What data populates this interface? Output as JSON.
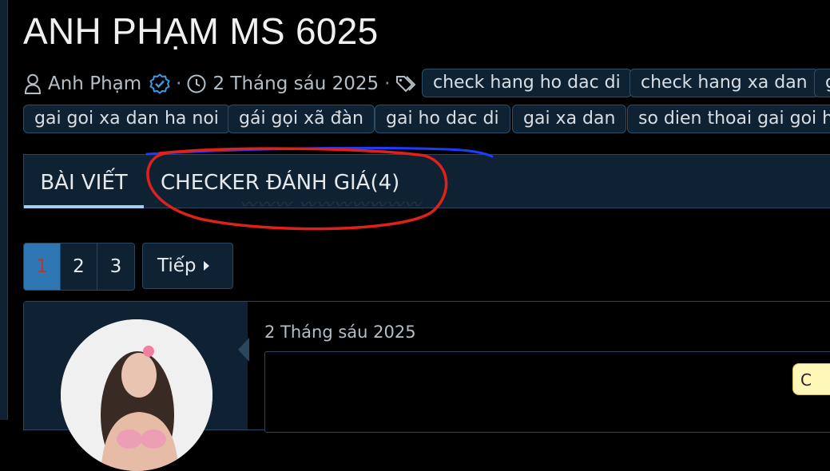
{
  "thread": {
    "title": "ANH PHẠM MS 6025",
    "author": "Anh Phạm",
    "date": "2 Tháng sáu 2025",
    "tags": [
      "check hang ho dac di",
      "check hang xa dan",
      "g",
      "gai goi xa dan ha noi",
      "gái gọi xã đàn",
      "gai ho dac di",
      "gai xa dan",
      "so dien thoai gai goi ho"
    ]
  },
  "tabs": [
    {
      "label": "BÀI VIẾT",
      "active": true
    },
    {
      "label": "CHECKER ĐÁNH GIÁ(4)",
      "active": false
    }
  ],
  "pagination": {
    "pages": [
      "1",
      "2",
      "3"
    ],
    "current": "1",
    "next_label": "Tiếp"
  },
  "post": {
    "date": "2 Tháng sáu 2025",
    "badge": "C"
  },
  "colors": {
    "accent": "#2f77b3",
    "tab_underline": "#9fd0f2",
    "panel": "#0f2233",
    "annotation_red": "#e0211b",
    "annotation_blue": "#1f3bff"
  }
}
